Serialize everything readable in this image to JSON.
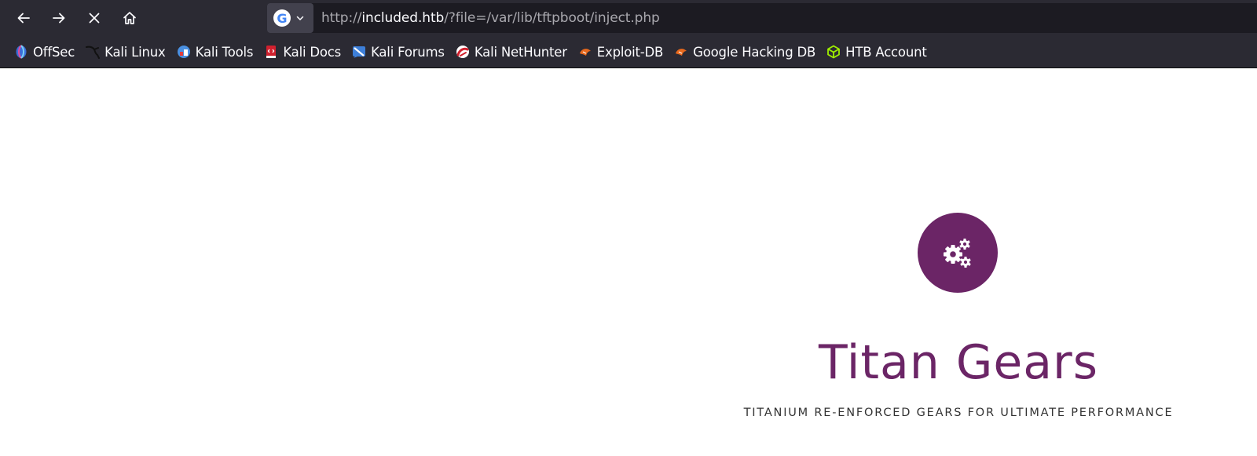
{
  "browser": {
    "url": {
      "scheme": "http://",
      "host": "included.htb",
      "path": "/?file=/var/lib/tftpboot/inject.php"
    },
    "search_engine_icon": "google-icon",
    "search_engine_letter": "G",
    "nav_icons": [
      "back-arrow-icon",
      "forward-arrow-icon",
      "stop-icon",
      "home-icon"
    ]
  },
  "bookmarks": [
    {
      "label": "OffSec",
      "icon": "offsec-icon",
      "color": "#3b6dd8"
    },
    {
      "label": "Kali Linux",
      "icon": "kali-dragon-icon",
      "color": "#111111"
    },
    {
      "label": "Kali Tools",
      "icon": "kali-tools-icon",
      "color": "#4a90e2"
    },
    {
      "label": "Kali Docs",
      "icon": "kali-docs-icon",
      "color": "#d0202e"
    },
    {
      "label": "Kali Forums",
      "icon": "kali-forums-icon",
      "color": "#3d7fd9"
    },
    {
      "label": "Kali NetHunter",
      "icon": "nethunter-icon",
      "color": "#d0202e"
    },
    {
      "label": "Exploit-DB",
      "icon": "exploit-db-icon",
      "color": "#e8691d"
    },
    {
      "label": "Google Hacking DB",
      "icon": "ghdb-icon",
      "color": "#e8691d"
    },
    {
      "label": "HTB Account",
      "icon": "htb-cube-icon",
      "color": "#9fef00"
    }
  ],
  "page": {
    "logo_icon": "gears-icon",
    "title": "Titan Gears",
    "tagline": "TITANIUM RE-ENFORCED GEARS FOR ULTIMATE PERFORMANCE",
    "brand_color": "#6b2566"
  }
}
